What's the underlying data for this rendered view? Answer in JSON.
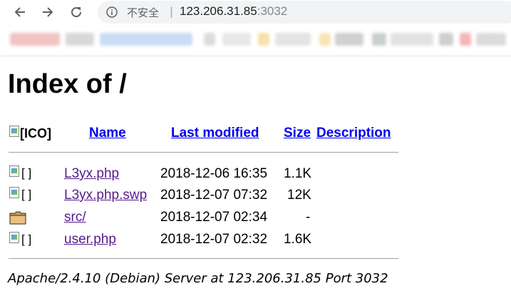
{
  "browser": {
    "security_label": "不安全",
    "separator": "|",
    "url_host": "123.206.31.85",
    "url_port": ":3032",
    "bookmark_colors": [
      "#f2c3c3",
      "#d8d8d8",
      "#c9dcf5",
      "#dcdcdc",
      "#e8e8e8",
      "#f6e1a8",
      "#e4e4e4",
      "#f6e6b4",
      "#d0d0d0",
      "#c8d0cc",
      "#e2e2e2",
      "#cfcfcf",
      "#f7b5b5",
      "#dcdcdc"
    ]
  },
  "page": {
    "title": "Index of /",
    "header_icon_alt": "[ICO]",
    "columns": {
      "name": "Name",
      "last_modified": "Last modified",
      "size": "Size",
      "description": "Description"
    },
    "rows": [
      {
        "icon": "broken-image-icon",
        "alt": "[ ]",
        "name": "L3yx.php",
        "modified": "2018-12-06 16:35",
        "size": "1.1K"
      },
      {
        "icon": "broken-image-icon",
        "alt": "[ ]",
        "name": "L3yx.php.swp",
        "modified": "2018-12-07 07:32",
        "size": "12K"
      },
      {
        "icon": "folder-icon",
        "alt": "",
        "name": "src/",
        "modified": "2018-12-07 02:34",
        "size": "-"
      },
      {
        "icon": "broken-image-icon",
        "alt": "[ ]",
        "name": "user.php",
        "modified": "2018-12-07 02:32",
        "size": "1.6K"
      }
    ],
    "footer": "Apache/2.4.10 (Debian) Server at 123.206.31.85 Port 3032"
  }
}
